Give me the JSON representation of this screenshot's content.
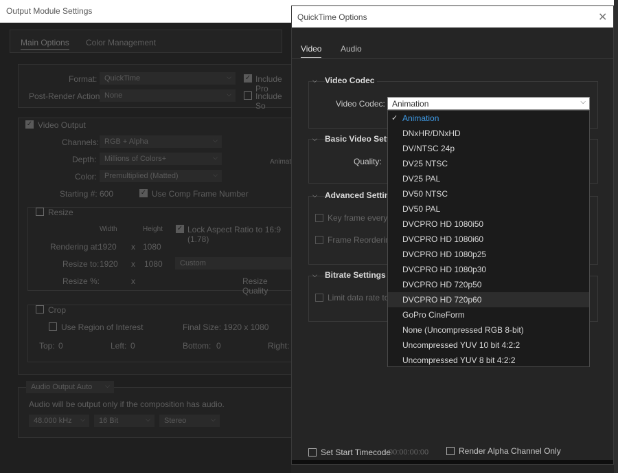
{
  "output_module": {
    "title": "Output Module Settings",
    "tabs": [
      "Main Options",
      "Color Management"
    ],
    "format_label": "Format:",
    "format_value": "QuickTime",
    "include_project_label": "Include Pro",
    "post_render_label": "Post-Render Action:",
    "post_render_value": "None",
    "include_source_label": "Include So",
    "video_output_label": "Video Output",
    "channels_label": "Channels:",
    "channels_value": "RGB + Alpha",
    "depth_label": "Depth:",
    "depth_value": "Millions of Colors+",
    "color_label": "Color:",
    "color_value": "Premultiplied (Matted)",
    "starting_label": "Starting #:",
    "starting_value": "600",
    "use_comp_frame_label": "Use Comp Frame Number",
    "animation_partial": "Animat",
    "resize_label": "Resize",
    "width_label": "Width",
    "height_label": "Height",
    "lock_aspect_label": "Lock Aspect Ratio to 16:9 (1.78)",
    "rendering_at_label": "Rendering at:",
    "rendering_w": "1920",
    "rendering_h": "1080",
    "resize_to_label": "Resize to:",
    "resize_w": "1920",
    "resize_h": "1080",
    "resize_preset": "Custom",
    "resize_pct_label": "Resize %:",
    "x_sep": "x",
    "resize_quality_label": "Resize Quality",
    "crop_label": "Crop",
    "use_roi_label": "Use Region of Interest",
    "final_size_label": "Final Size: 1920 x 1080",
    "top_label": "Top:",
    "top_value": "0",
    "left_label": "Left:",
    "left_value": "0",
    "bottom_label": "Bottom:",
    "bottom_value": "0",
    "right_label": "Right:",
    "audio_output_label": "Audio Output Auto",
    "audio_note": "Audio will be output only if the composition has audio.",
    "sample_rate": "48.000 kHz",
    "bit_depth": "16 Bit",
    "channels_audio": "Stereo"
  },
  "quicktime": {
    "title": "QuickTime Options",
    "tabs": [
      "Video",
      "Audio"
    ],
    "video_codec_section": "Video Codec",
    "video_codec_label": "Video Codec:",
    "video_codec_value": "Animation",
    "basic_section": "Basic Video Settin",
    "quality_label": "Quality:",
    "advanced_section": "Advanced Setting",
    "key_frame_label": "Key frame every",
    "frame_reorder_label": "Frame Reordering",
    "bitrate_section": "Bitrate Settings",
    "limit_rate_label": "Limit data rate to",
    "set_start_tc_label": "Set Start Timecode",
    "start_tc_value": "00:00:00:00",
    "render_alpha_label": "Render Alpha Channel Only",
    "codec_options": [
      "Animation",
      "DNxHR/DNxHD",
      "DV/NTSC 24p",
      "DV25 NTSC",
      "DV25 PAL",
      "DV50 NTSC",
      "DV50 PAL",
      "DVCPRO HD 1080i50",
      "DVCPRO HD 1080i60",
      "DVCPRO HD 1080p25",
      "DVCPRO HD 1080p30",
      "DVCPRO HD 720p50",
      "DVCPRO HD 720p60",
      "GoPro CineForm",
      "None (Uncompressed RGB 8-bit)",
      "Uncompressed YUV 10 bit 4:2:2",
      "Uncompressed YUV 8 bit 4:2:2"
    ],
    "selected_index": 0,
    "hover_index": 12
  },
  "colors": {
    "accent": "#3f9ce8"
  }
}
